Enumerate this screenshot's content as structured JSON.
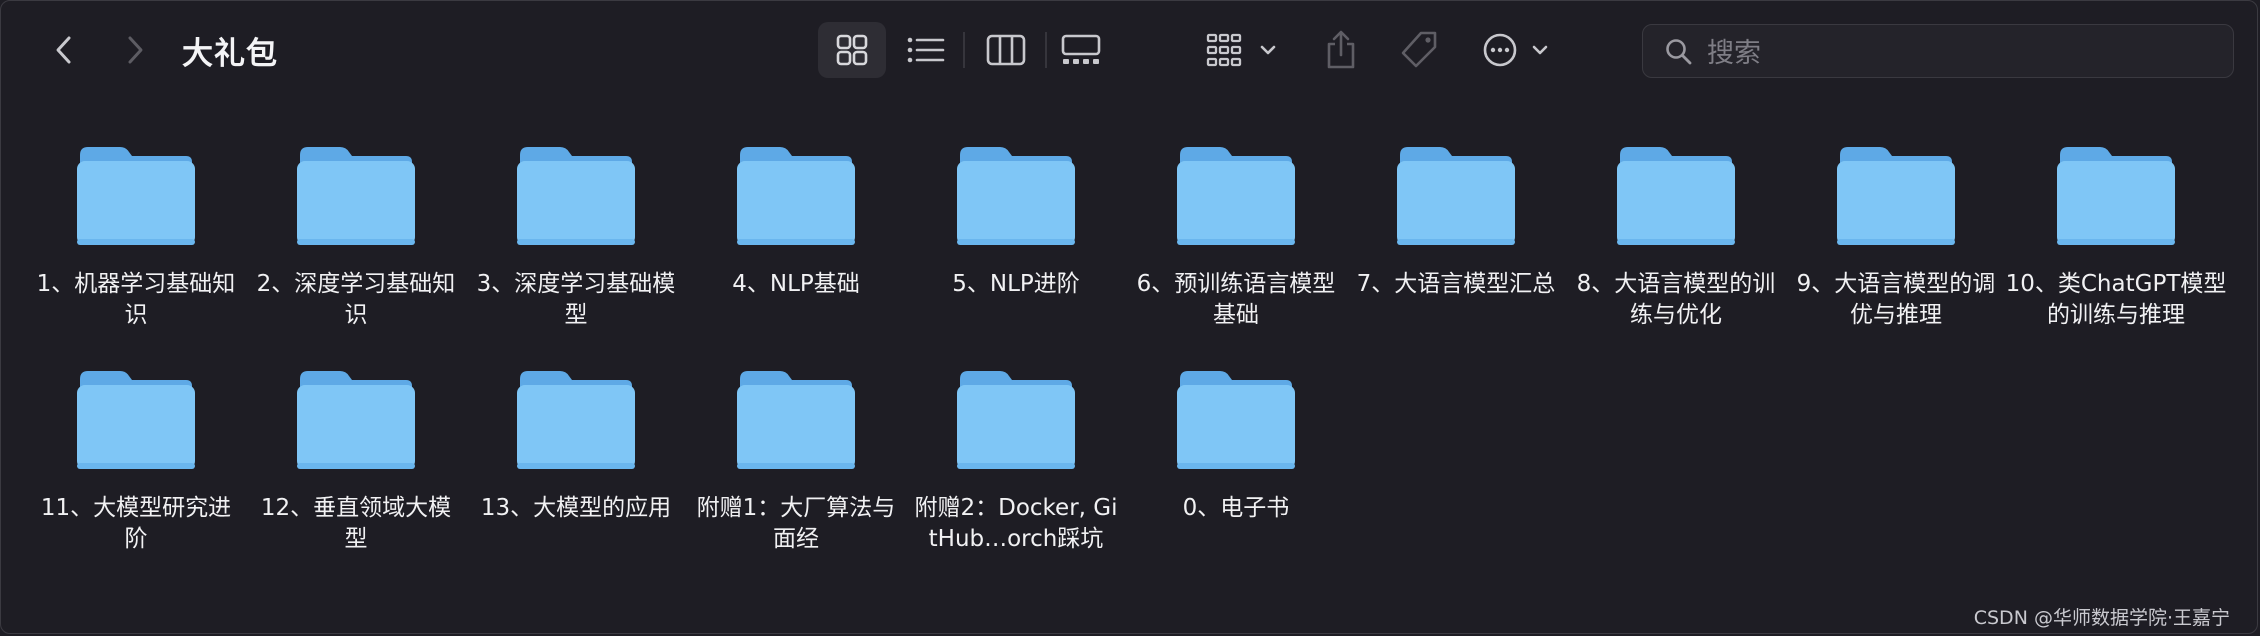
{
  "window": {
    "title": "大礼包"
  },
  "toolbar": {
    "back_icon": "chevron-left-icon",
    "forward_icon": "chevron-right-icon",
    "views": [
      {
        "name": "icon-view",
        "icon": "grid-icon",
        "active": true
      },
      {
        "name": "list-view",
        "icon": "list-icon",
        "active": false
      },
      {
        "name": "column-view",
        "icon": "columns-icon",
        "active": false
      },
      {
        "name": "gallery-view",
        "icon": "gallery-icon",
        "active": false
      }
    ],
    "group_icon": "group-grid-icon",
    "share_icon": "share-icon",
    "tag_icon": "tag-icon",
    "more_icon": "ellipsis-circle-icon"
  },
  "search": {
    "placeholder": "搜索",
    "value": ""
  },
  "folders": [
    {
      "label": "1、机器学习基础知识"
    },
    {
      "label": "2、深度学习基础知识"
    },
    {
      "label": "3、深度学习基础模型"
    },
    {
      "label": "4、NLP基础"
    },
    {
      "label": "5、NLP进阶"
    },
    {
      "label": "6、预训练语言模型基础"
    },
    {
      "label": "7、大语言模型汇总"
    },
    {
      "label": "8、大语言模型的训练与优化"
    },
    {
      "label": "9、大语言模型的调优与推理"
    },
    {
      "label": "10、类ChatGPT模型的训练与推理"
    },
    {
      "label": "11、大模型研究进阶"
    },
    {
      "label": "12、垂直领域大模型"
    },
    {
      "label": "13、大模型的应用"
    },
    {
      "label": "附赠1：大厂算法与面经"
    },
    {
      "label": "附赠2：Docker, GitHub…orch踩坑"
    },
    {
      "label": "0、电子书"
    }
  ],
  "watermark": "CSDN @华师数据学院·王嘉宁",
  "colors": {
    "background": "#1e1d24",
    "folder_body": "#7fc6f6",
    "folder_tab": "#5ea9e6",
    "text": "#f1f1f3"
  }
}
